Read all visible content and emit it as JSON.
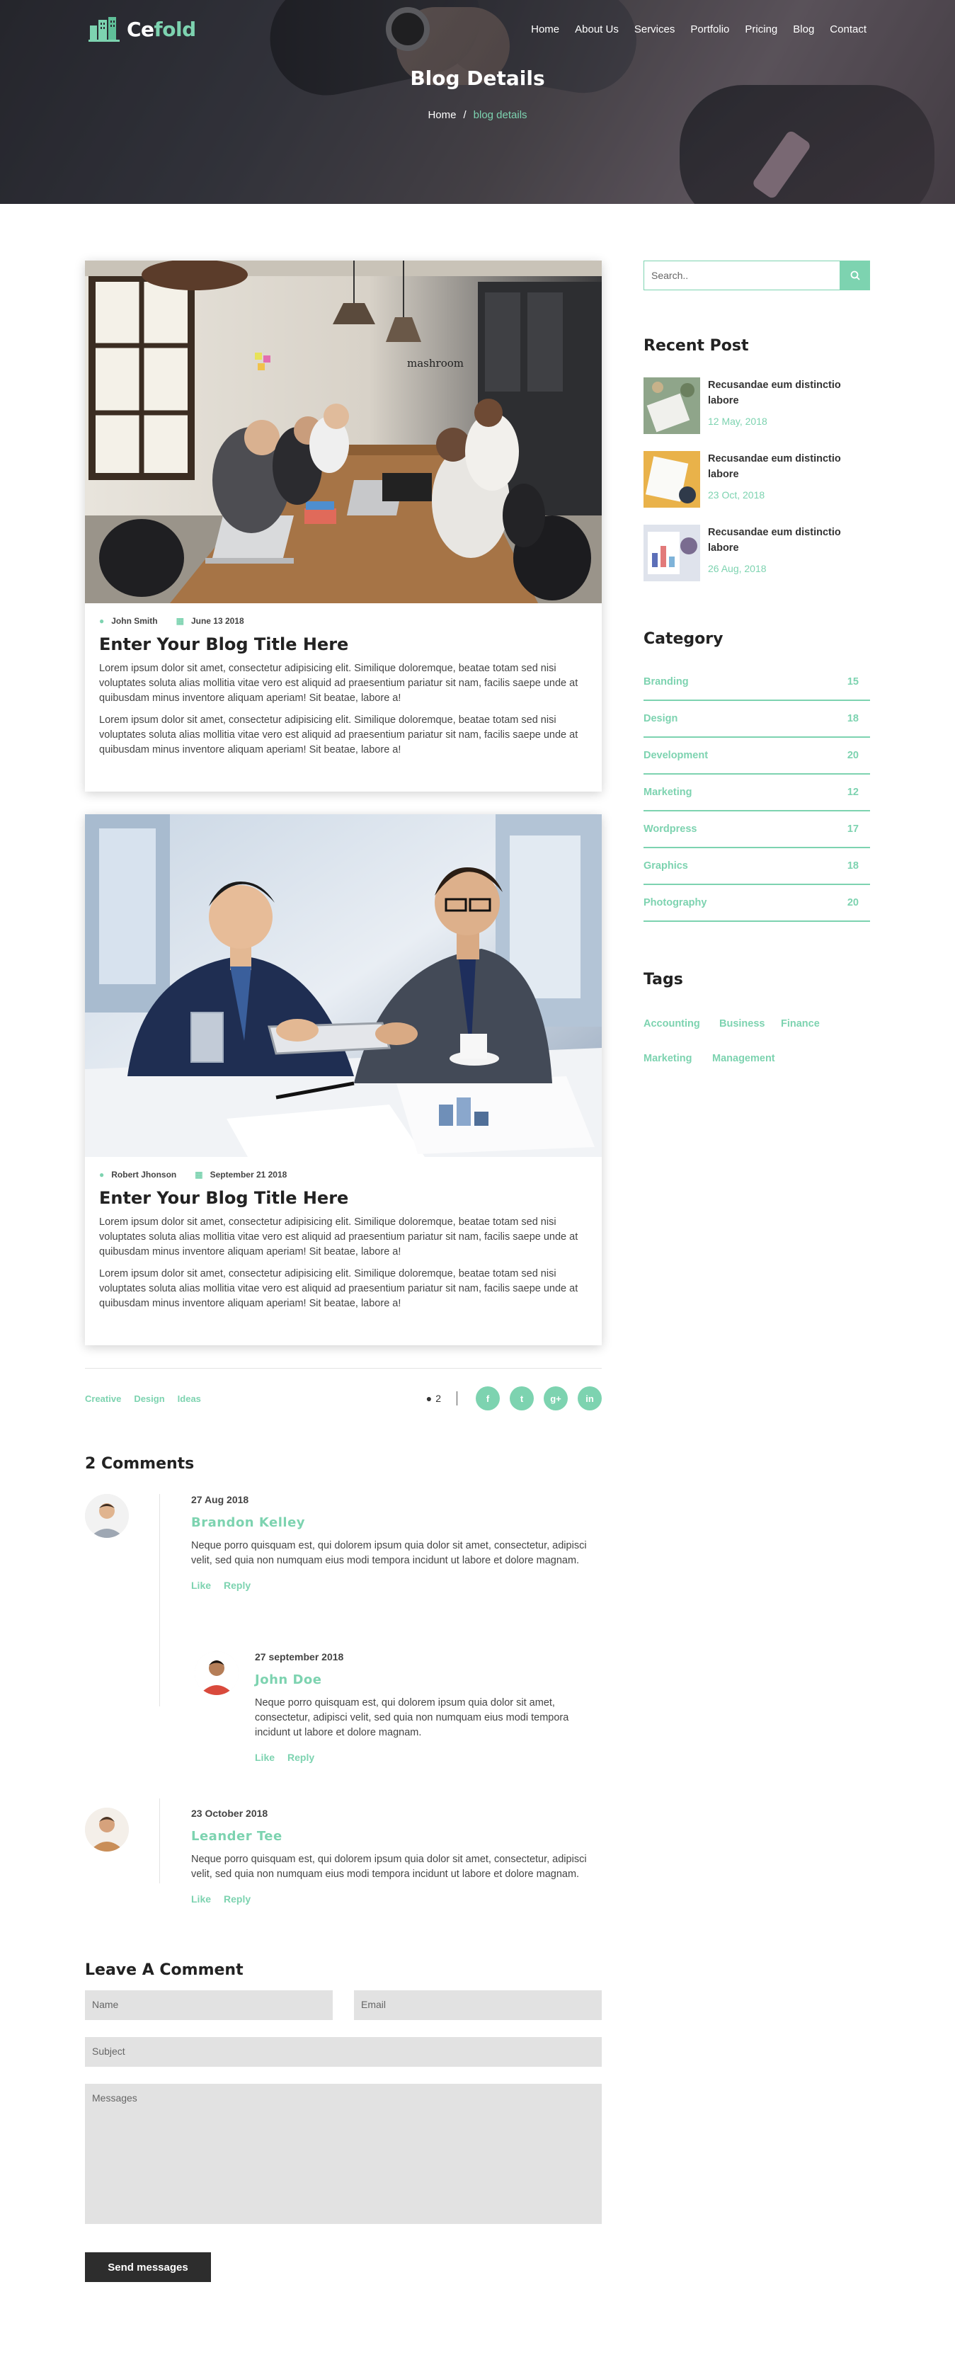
{
  "header": {
    "brand_main": "Ce",
    "brand_accent": "fold",
    "nav": [
      "Home",
      "About Us",
      "Services",
      "Portfolio",
      "Pricing",
      "Blog",
      "Contact"
    ],
    "page_title": "Blog Details",
    "breadcrumb_home": "Home",
    "breadcrumb_sep": "/",
    "breadcrumb_current": "blog details"
  },
  "posts": [
    {
      "author": "John Smith",
      "date": "June 13 2018",
      "title": "Enter Your Blog Title Here",
      "para1": "Lorem ipsum dolor sit amet, consectetur adipisicing elit. Similique doloremque, beatae totam sed nisi voluptates soluta alias mollitia vitae vero est aliquid ad praesentium pariatur sit nam, facilis saepe unde at quibusdam minus inventore aliquam aperiam! Sit beatae, labore a!",
      "para2": "Lorem ipsum dolor sit amet, consectetur adipisicing elit. Similique doloremque, beatae totam sed nisi voluptates soluta alias mollitia vitae vero est aliquid ad praesentium pariatur sit nam, facilis saepe unde at quibusdam minus inventore aliquam aperiam! Sit beatae, labore a!",
      "image_sign": "mashroom"
    },
    {
      "author": "Robert Jhonson",
      "date": "September 21 2018",
      "title": "Enter Your Blog Title Here",
      "para1": "Lorem ipsum dolor sit amet, consectetur adipisicing elit. Similique doloremque, beatae totam sed nisi voluptates soluta alias mollitia vitae vero est aliquid ad praesentium pariatur sit nam, facilis saepe unde at quibusdam minus inventore aliquam aperiam! Sit beatae, labore a!",
      "para2": "Lorem ipsum dolor sit amet, consectetur adipisicing elit. Similique doloremque, beatae totam sed nisi voluptates soluta alias mollitia vitae vero est aliquid ad praesentium pariatur sit nam, facilis saepe unde at quibusdam minus inventore aliquam aperiam! Sit beatae, labore a!"
    }
  ],
  "post_tags": [
    "Creative",
    "Design",
    "Ideas"
  ],
  "comment_count": "2",
  "social": [
    "f",
    "t",
    "g+",
    "in"
  ],
  "comments_heading": "2 Comments",
  "comments": [
    {
      "date": "27 Aug 2018",
      "name": "Brandon Kelley",
      "text": "Neque porro quisquam est, qui dolorem ipsum quia dolor sit amet, consectetur, adipisci velit, sed quia non numquam eius modi tempora incidunt ut labore et dolore magnam.",
      "like": "Like",
      "reply": "Reply"
    },
    {
      "date": "27 september 2018",
      "name": "John Doe",
      "text": "Neque porro quisquam est, qui dolorem ipsum quia dolor sit amet, consectetur, adipisci velit, sed quia non numquam eius modi tempora incidunt ut labore et dolore magnam.",
      "like": "Like",
      "reply": "Reply"
    },
    {
      "date": "23 October 2018",
      "name": "Leander Tee",
      "text": "Neque porro quisquam est, qui dolorem ipsum quia dolor sit amet, consectetur, adipisci velit, sed quia non numquam eius modi tempora incidunt ut labore et dolore magnam.",
      "like": "Like",
      "reply": "Reply"
    }
  ],
  "form": {
    "heading": "Leave A Comment",
    "name_placeholder": "Name",
    "email_placeholder": "Email",
    "subject_placeholder": "Subject",
    "message_placeholder": "Messages",
    "submit": "Send messages"
  },
  "sidebar": {
    "search_placeholder": "Search..",
    "recent_heading": "Recent Post",
    "recent": [
      {
        "title": "Recusandae eum distinctio labore",
        "date": "12 May, 2018"
      },
      {
        "title": "Recusandae eum distinctio labore",
        "date": "23 Oct, 2018"
      },
      {
        "title": "Recusandae eum distinctio labore",
        "date": "26 Aug, 2018"
      }
    ],
    "category_heading": "Category",
    "categories": [
      {
        "name": "Branding",
        "count": "15"
      },
      {
        "name": "Design",
        "count": "18"
      },
      {
        "name": "Development",
        "count": "20"
      },
      {
        "name": "Marketing",
        "count": "12"
      },
      {
        "name": "Wordpress",
        "count": "17"
      },
      {
        "name": "Graphics",
        "count": "18"
      },
      {
        "name": "Photography",
        "count": "20"
      }
    ],
    "tags_heading": "Tags",
    "tags": [
      "Accounting",
      "Business",
      "Finance",
      "Marketing",
      "Management"
    ]
  },
  "colors": {
    "accent": "#7dd3b0",
    "dark": "#2d2d2d",
    "field": "#e2e2e2"
  }
}
